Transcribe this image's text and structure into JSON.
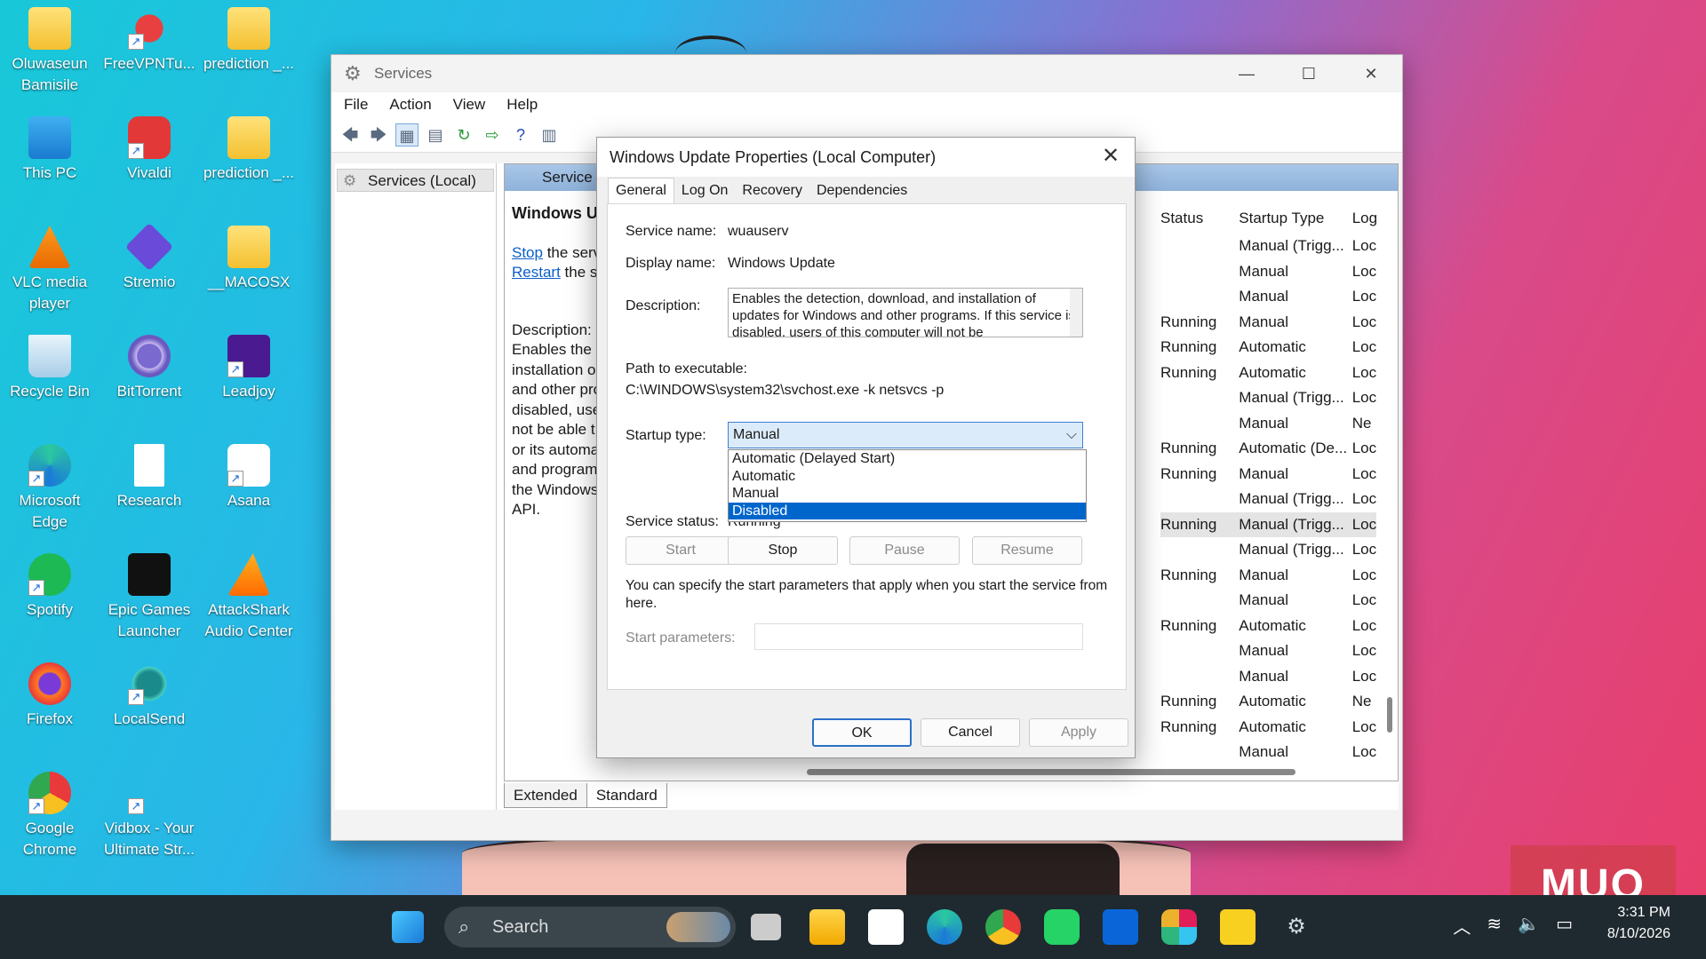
{
  "desktop": {
    "icons": [
      {
        "label": "Oluwaseun Bamisile"
      },
      {
        "label": "FreeVPNTu..."
      },
      {
        "label": "prediction _..."
      },
      {
        "label": "This PC"
      },
      {
        "label": "Vivaldi"
      },
      {
        "label": "prediction _..."
      },
      {
        "label": "VLC media player"
      },
      {
        "label": "Stremio"
      },
      {
        "label": "__MACOSX"
      },
      {
        "label": "Recycle Bin"
      },
      {
        "label": "BitTorrent"
      },
      {
        "label": "Leadjoy"
      },
      {
        "label": "Microsoft Edge"
      },
      {
        "label": "Research"
      },
      {
        "label": "Asana"
      },
      {
        "label": "Spotify"
      },
      {
        "label": "Epic Games Launcher"
      },
      {
        "label": "AttackShark Audio Center"
      },
      {
        "label": "Firefox"
      },
      {
        "label": "LocalSend"
      },
      {
        "label": "Google Chrome"
      },
      {
        "label": "Vidbox - Your Ultimate Str..."
      }
    ]
  },
  "services_window": {
    "title": "Services",
    "menu": [
      "File",
      "Action",
      "View",
      "Help"
    ],
    "tree_item": "Services (Local)",
    "pane_header": "Service",
    "selected_service": "Windows Up",
    "stop_link": "Stop",
    "stop_suffix": " the serv",
    "restart_link": "Restart",
    "restart_suffix": " the se",
    "description_label": "Description:",
    "description_lines": [
      "Enables the d",
      "installation o",
      "and other pro",
      "disabled, use",
      "not be able t",
      "or its automa",
      "and program",
      "the Windows",
      "API."
    ],
    "columns": {
      "status": "Status",
      "startup": "Startup Type",
      "logon": "Log"
    },
    "rows": [
      {
        "status": "",
        "startup": "Manual (Trigg...",
        "logon": "Loc"
      },
      {
        "status": "",
        "startup": "Manual",
        "logon": "Loc"
      },
      {
        "status": "",
        "startup": "Manual",
        "logon": "Loc"
      },
      {
        "status": "Running",
        "startup": "Manual",
        "logon": "Loc"
      },
      {
        "status": "Running",
        "startup": "Automatic",
        "logon": "Loc"
      },
      {
        "status": "Running",
        "startup": "Automatic",
        "logon": "Loc"
      },
      {
        "status": "",
        "startup": "Manual (Trigg...",
        "logon": "Loc"
      },
      {
        "status": "",
        "startup": "Manual",
        "logon": "Ne"
      },
      {
        "status": "Running",
        "startup": "Automatic (De...",
        "logon": "Loc"
      },
      {
        "status": "Running",
        "startup": "Manual",
        "logon": "Loc"
      },
      {
        "status": "",
        "startup": "Manual (Trigg...",
        "logon": "Loc"
      },
      {
        "status": "Running",
        "startup": "Manual (Trigg...",
        "logon": "Loc"
      },
      {
        "status": "",
        "startup": "Manual (Trigg...",
        "logon": "Loc"
      },
      {
        "status": "Running",
        "startup": "Manual",
        "logon": "Loc"
      },
      {
        "status": "",
        "startup": "Manual",
        "logon": "Loc"
      },
      {
        "status": "Running",
        "startup": "Automatic",
        "logon": "Loc"
      },
      {
        "status": "",
        "startup": "Manual",
        "logon": "Loc"
      },
      {
        "status": "",
        "startup": "Manual",
        "logon": "Loc"
      },
      {
        "status": "Running",
        "startup": "Automatic",
        "logon": "Ne"
      },
      {
        "status": "Running",
        "startup": "Automatic",
        "logon": "Loc"
      },
      {
        "status": "",
        "startup": "Manual",
        "logon": "Loc"
      }
    ],
    "bottom_tabs": [
      "Extended",
      "Standard"
    ]
  },
  "dialog": {
    "title": "Windows Update Properties (Local Computer)",
    "tabs": [
      "General",
      "Log On",
      "Recovery",
      "Dependencies"
    ],
    "service_name_label": "Service name:",
    "service_name": "wuauserv",
    "display_name_label": "Display name:",
    "display_name": "Windows Update",
    "description_label": "Description:",
    "description": "Enables the detection, download, and installation of updates for Windows and other programs. If this service is disabled, users of this computer will not be",
    "path_label": "Path to executable:",
    "path": "C:\\WINDOWS\\system32\\svchost.exe -k netsvcs -p",
    "startup_type_label": "Startup type:",
    "startup_type_value": "Manual",
    "startup_options": [
      "Automatic (Delayed Start)",
      "Automatic",
      "Manual",
      "Disabled"
    ],
    "startup_highlighted": "Disabled",
    "service_status_label": "Service status:",
    "service_status": "Running",
    "start_btn": "Start",
    "stop_btn": "Stop",
    "pause_btn": "Pause",
    "resume_btn": "Resume",
    "info_text": "You can specify the start parameters that apply when you start the service from here.",
    "start_params_label": "Start parameters:",
    "ok_btn": "OK",
    "cancel_btn": "Cancel",
    "apply_btn": "Apply"
  },
  "taskbar": {
    "search_placeholder": "Search",
    "time": "3:31 PM",
    "date": "8/10/2026"
  },
  "watermark": "MUO"
}
